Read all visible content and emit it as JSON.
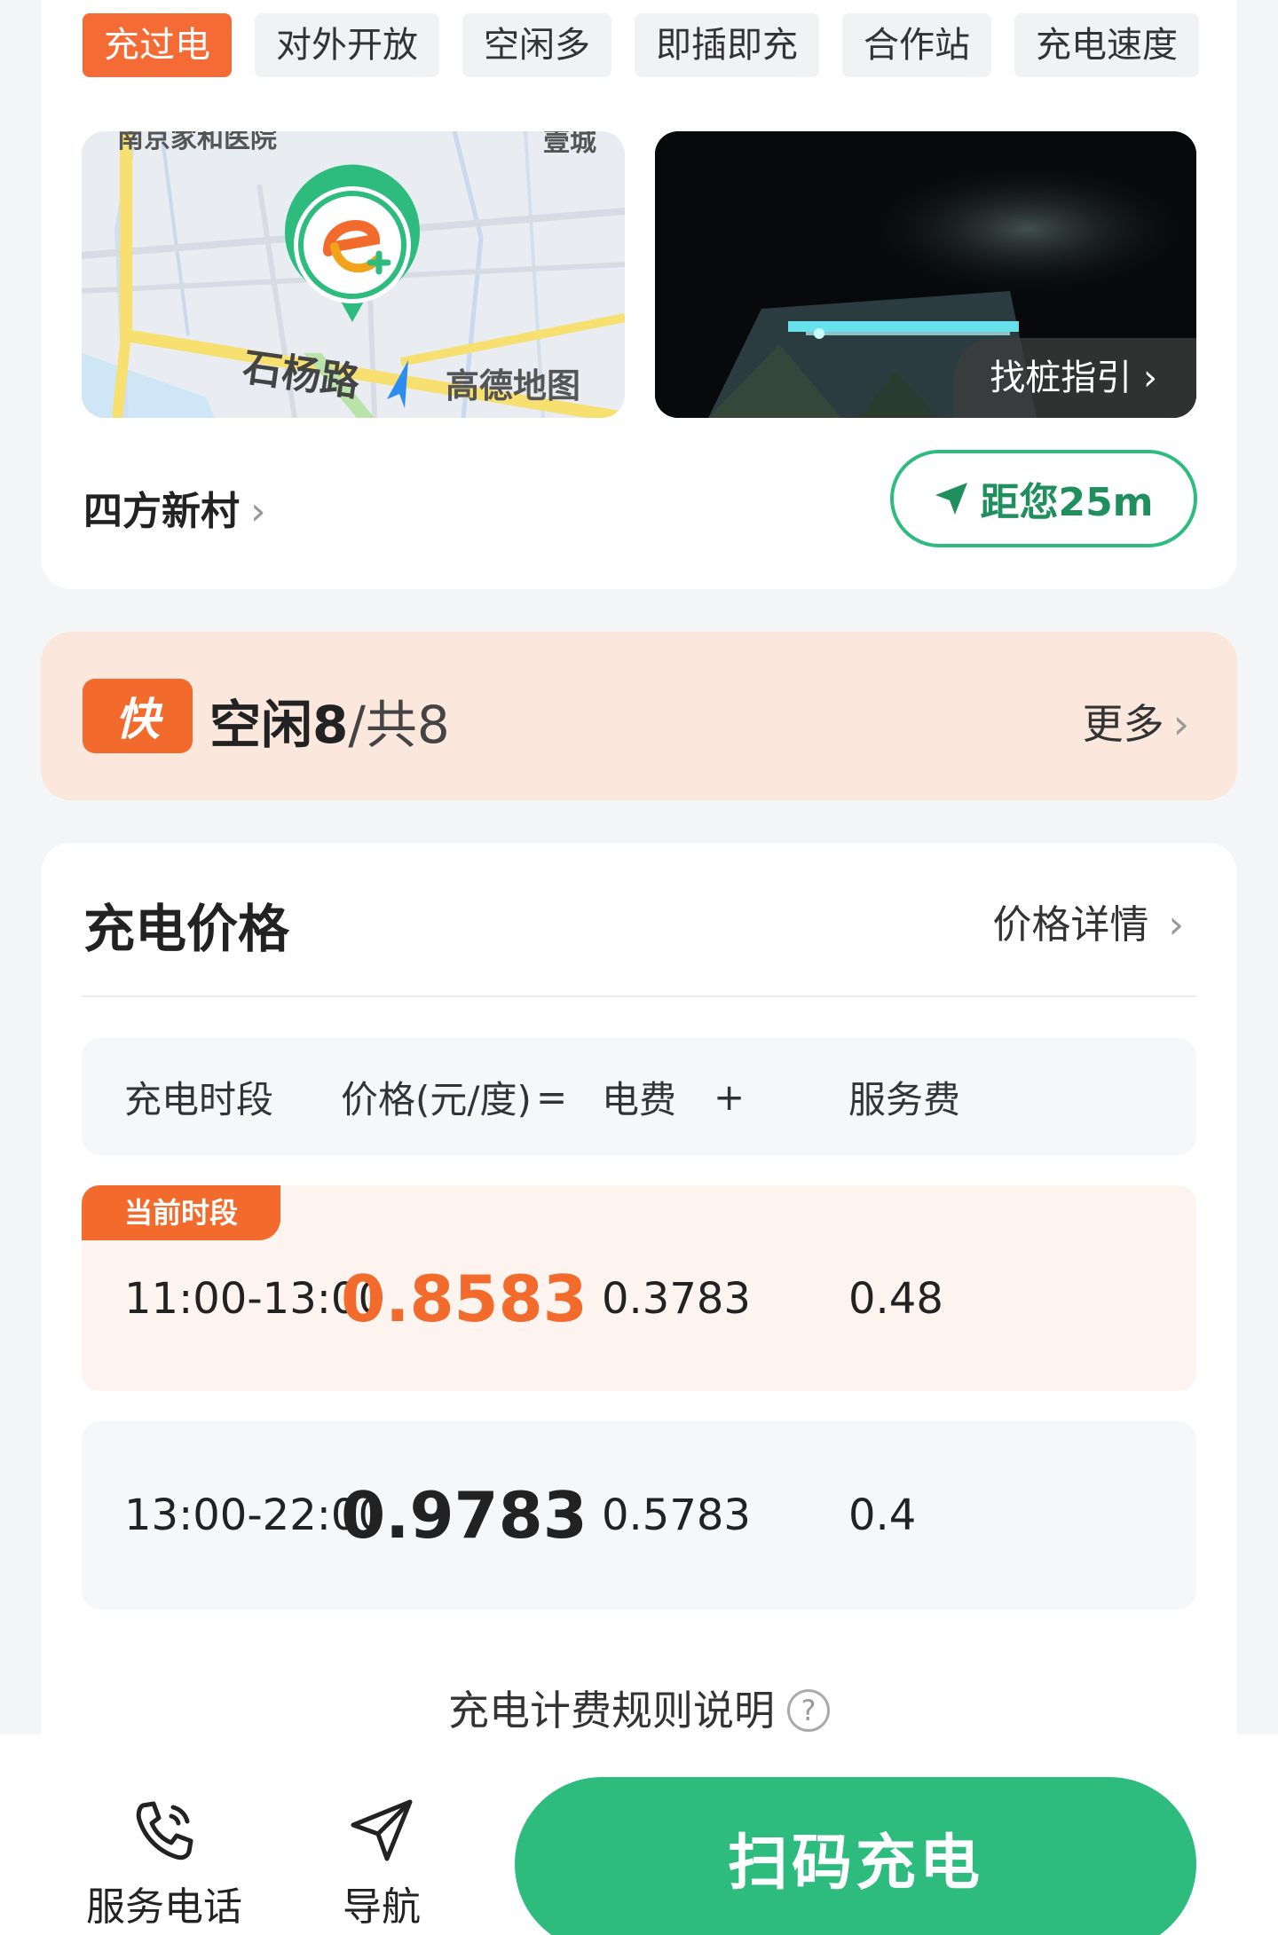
{
  "tags": [
    "充过电",
    "对外开放",
    "空闲多",
    "即插即充",
    "合作站",
    "充电速度"
  ],
  "map": {
    "road_label": "石杨路",
    "provider": "高德地图",
    "top_left_label": "南京家和医院",
    "top_right_label": "壹城"
  },
  "photo": {
    "guide_label": "找桩指引"
  },
  "station": {
    "name": "四方新村",
    "distance_label": "距您25m"
  },
  "availability": {
    "badge": "快",
    "free_label": "空闲8",
    "total_label": "/共8",
    "more_label": "更多"
  },
  "pricing": {
    "title": "充电价格",
    "detail_link": "价格详情",
    "headers": {
      "period": "充电时段",
      "price": "价格(元/度)",
      "equals": "=",
      "electricity": "电费",
      "plus": "+",
      "service": "服务费"
    },
    "current_tag": "当前时段",
    "rows": [
      {
        "period": "11:00-13:00",
        "price": "0.8583",
        "electricity": "0.3783",
        "service": "0.48"
      },
      {
        "period": "13:00-22:00",
        "price": "0.9783",
        "electricity": "0.5783",
        "service": "0.4"
      }
    ],
    "rules_link": "充电计费规则说明",
    "help_glyph": "?"
  },
  "bottom_bar": {
    "phone_label": "服务电话",
    "navigate_label": "导航",
    "scan_label": "扫码充电"
  },
  "colors": {
    "accent_orange": "#f26b2c",
    "accent_green": "#2dbb7e",
    "free_card_bg": "#fbe7dc"
  }
}
